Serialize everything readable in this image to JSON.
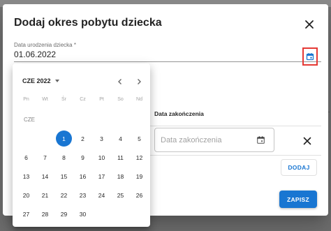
{
  "dialog": {
    "title": "Dodaj okres pobytu dziecka",
    "birth_date_label": "Data urodzenia dziecka *",
    "birth_date_value": "01.06.2022",
    "end_date_header": "Data zakończenia",
    "end_date_placeholder": "Data zakończenia",
    "add_label": "DODAJ",
    "save_label": "ZAPISZ"
  },
  "calendar": {
    "month_year": "CZE 2022",
    "month_short": "CZE",
    "weekdays": [
      "Pn",
      "Wt",
      "Śr",
      "Cz",
      "Pt",
      "So",
      "Nd"
    ],
    "first_weekday_index": 2,
    "days": [
      "1",
      "2",
      "3",
      "4",
      "5",
      "6",
      "7",
      "8",
      "9",
      "10",
      "11",
      "12",
      "13",
      "14",
      "15",
      "16",
      "17",
      "18",
      "19",
      "20",
      "21",
      "22",
      "23",
      "24",
      "25",
      "26",
      "27",
      "28",
      "29",
      "30"
    ],
    "selected_day": "1"
  },
  "colors": {
    "primary": "#1976d2",
    "highlight": "#e53935"
  }
}
